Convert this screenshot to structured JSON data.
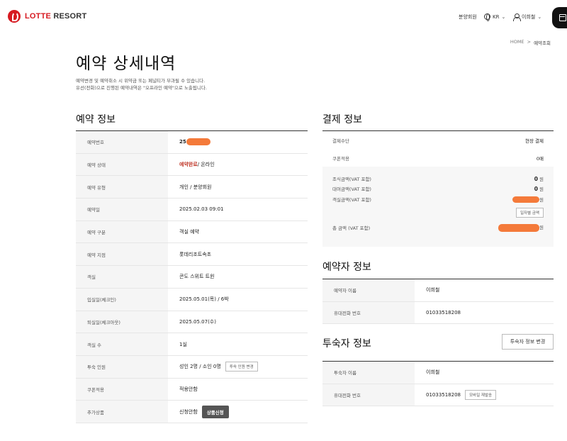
{
  "header": {
    "brand": "LOTTE",
    "brand_suffix": "RESORT",
    "nav_membership": "분양회원",
    "lang": "KR",
    "user": "이희철"
  },
  "breadcrumb": {
    "home": "HOME",
    "sep": ">",
    "current": "예약조회"
  },
  "page": {
    "title": "예약 상세내역",
    "notice_1": "예약변경 및 예약취소 시 위약금 또는 페널티가 부과될 수 있습니다.",
    "notice_2": "유선(전화)으로 진행된 예약내역은 \"오프라인 예약\"으로 노출됩니다."
  },
  "reservation": {
    "title": "예약 정보",
    "rows": [
      {
        "label": "예약번호",
        "value": "25"
      },
      {
        "label": "예약 상태",
        "status": "예약완료",
        "value": " / 온라인"
      },
      {
        "label": "예약 유형",
        "value": "개인 / 분양회원"
      },
      {
        "label": "예약일",
        "value": "2025.02.03 09:01"
      },
      {
        "label": "예약 구분",
        "value": "객실 예약"
      },
      {
        "label": "예약 지점",
        "value": "롯데리조트속초"
      },
      {
        "label": "객실",
        "value": "콘도 스위트 트윈"
      },
      {
        "label": "입실일(체크인)",
        "value": "2025.05.01(목) / 6박"
      },
      {
        "label": "퇴실일(체크아웃)",
        "value": "2025.05.07(수)"
      },
      {
        "label": "객실 수",
        "value": "1실"
      },
      {
        "label": "투숙 인원",
        "value": "성인 2명 / 소인 0명",
        "button": "투숙 인원 변경"
      },
      {
        "label": "쿠폰적용",
        "value": "적용안함"
      },
      {
        "label": "추가상품",
        "value": "신청안함",
        "button": "상품신청"
      }
    ]
  },
  "payment": {
    "title": "결제 정보",
    "method_label": "결제수단",
    "method_value": "현장 결제",
    "coupon_label": "쿠폰적용",
    "coupon_value": "0매",
    "breakfast_label": "조식금액(VAT 포함)",
    "breakfast_value": "0",
    "rental_label": "대여금액(VAT 포함)",
    "rental_value": "0",
    "room_label": "객실금액(VAT 포함)",
    "daily_button": "일자별 금액",
    "total_label": "총 금액 (VAT 포함)",
    "currency": "원"
  },
  "booker": {
    "title": "예약자 정보",
    "name_label": "예약자 이름",
    "name_value": "이희철",
    "phone_label": "휴대전화 번호",
    "phone_value": "01033518208"
  },
  "guest": {
    "title": "투숙자 정보",
    "change_button": "투숙자 정보 변경",
    "name_label": "투숙자 이름",
    "name_value": "이희철",
    "phone_label": "휴대전화 번호",
    "phone_value": "01033518208",
    "resend_button": "모바일 재발송"
  },
  "colors": {
    "brand": "#d71a21",
    "status": "#c0392b",
    "redaction": "#f47a3a"
  }
}
